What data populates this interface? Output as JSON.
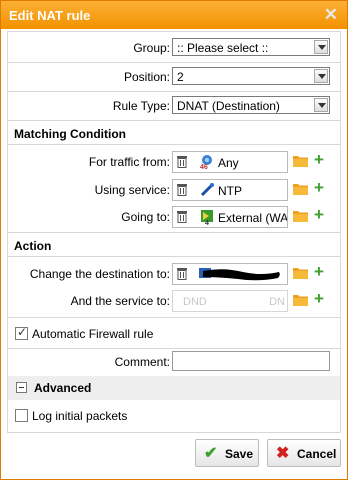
{
  "dialog": {
    "title": "Edit NAT rule",
    "close_glyph": "✕"
  },
  "fields": {
    "group": {
      "label": "Group:",
      "value": ":: Please select ::"
    },
    "position": {
      "label": "Position:",
      "value": "2"
    },
    "rule_type": {
      "label": "Rule Type:",
      "value": "DNAT (Destination)"
    }
  },
  "matching": {
    "heading": "Matching Condition",
    "traffic_from": {
      "label": "For traffic from:",
      "value": "Any",
      "icon": "network-any-icon"
    },
    "service": {
      "label": "Using service:",
      "value": "NTP",
      "icon": "service-icon"
    },
    "going_to": {
      "label": "Going to:",
      "value": "External (WAN",
      "icon": "interface-icon"
    }
  },
  "action": {
    "heading": "Action",
    "change_dest": {
      "label": "Change the destination to:",
      "value": ""
    },
    "service_to": {
      "label": "And the service to:",
      "placeholder_left": "DND",
      "placeholder_right": "DN"
    }
  },
  "firewall": {
    "label": "Automatic Firewall rule",
    "checked": true
  },
  "comment": {
    "label": "Comment:",
    "value": ""
  },
  "advanced": {
    "heading": "Advanced",
    "log_label": "Log initial packets",
    "log_checked": false
  },
  "buttons": {
    "save": "Save",
    "cancel": "Cancel",
    "save_icon": "✔",
    "cancel_icon": "✖"
  },
  "colors": {
    "title_bar": "#f39200",
    "accent_green": "#3fa12f",
    "cancel_red": "#d02020",
    "folder": "#f0a020"
  }
}
